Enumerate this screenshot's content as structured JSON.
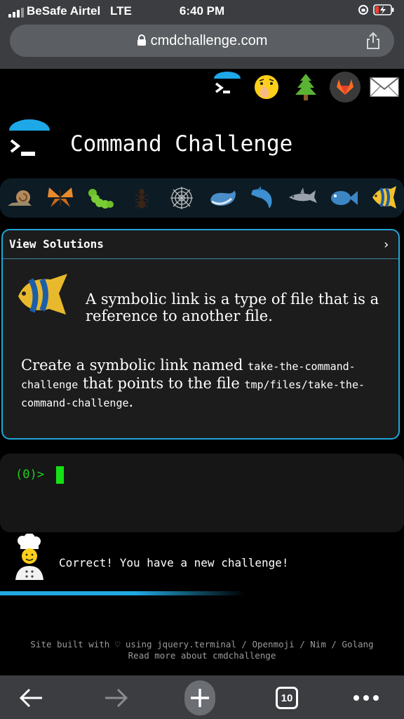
{
  "statusbar": {
    "carrier": "BeSafe Airtel",
    "network": "LTE",
    "time": "6:40 PM"
  },
  "browser": {
    "url": "cmdchallenge.com",
    "tab_count": "10"
  },
  "page": {
    "title": "Command Challenge",
    "top_icons": [
      "terminal-icon",
      "shushing-face-icon",
      "tree-icon",
      "gitlab-icon",
      "mail-icon"
    ],
    "progress_animals": [
      "snail-icon",
      "butterfly-icon",
      "caterpillar-icon",
      "ant-icon",
      "spider-web-icon",
      "whale-icon",
      "dolphin-icon",
      "shark-icon",
      "fish-icon",
      "tropical-fish-icon"
    ],
    "solutions_label": "View Solutions",
    "solutions_chevron": "›",
    "description": "A symbolic link is a type of file that is a reference to another file.",
    "task": {
      "part1": "Create a symbolic link named ",
      "code1": "take-the-command-challenge",
      "part2": " that points to the file ",
      "code2": "tmp/files/take-the-command-challenge",
      "part3": "."
    },
    "terminal_prompt": "(0)>",
    "feedback": "Correct! You have a new challenge!",
    "footer_line1": "Site built with ♡ using jquery.terminal / Openmoji / Nim / Golang",
    "footer_line2": "Read more about cmdchallenge"
  },
  "colors": {
    "accent": "#21a6d9",
    "terminal_green": "#1fd21f",
    "chrome": "#3b3d40"
  }
}
